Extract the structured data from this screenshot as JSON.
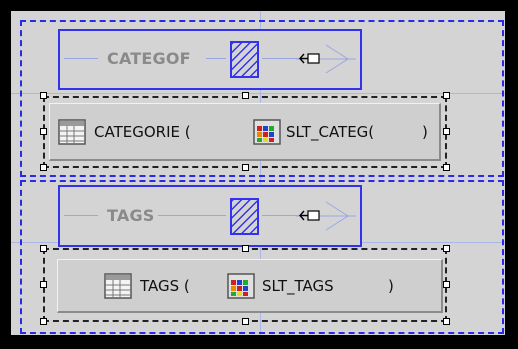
{
  "colors": {
    "accent_blue": "#3333ee",
    "guide_blue": "#a9b6e6",
    "canvas_gray": "#d4d4d4"
  },
  "sections": [
    {
      "band_label": "CATEGOF",
      "field": {
        "name_text": "CATEGORIE (",
        "source_text": "SLT_CATEG(",
        "close_text": ")",
        "table_icon": "table-grid-icon",
        "source_icon": "colored-blocks-icon"
      }
    },
    {
      "band_label": "TAGS",
      "field": {
        "name_text": "TAGS  (",
        "source_text": "SLT_TAGS",
        "close_text": ")",
        "table_icon": "table-grid-icon",
        "source_icon": "colored-blocks-icon"
      }
    }
  ],
  "icons": {
    "band_swatch": "hatched-swatch-icon",
    "band_arrow": "arrow-left-icon"
  }
}
